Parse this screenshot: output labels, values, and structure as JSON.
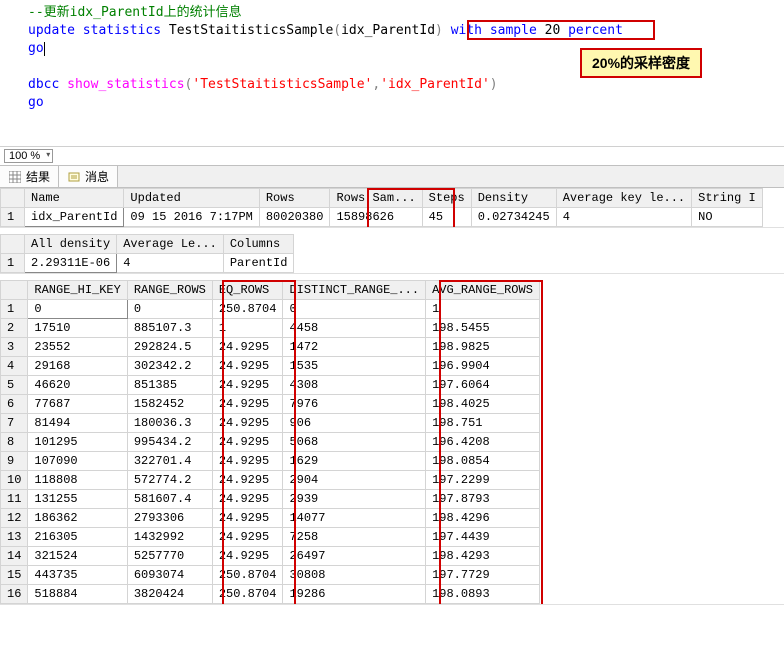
{
  "code": {
    "c1": "--更新idx_ParentId上的统计信息",
    "c2a": "update",
    "c2b": "statistics",
    "c2c": "TestStaitisticsSample",
    "c2d": "(",
    "c2e": "idx_ParentId",
    "c2f": ")",
    "c2g": "with",
    "c2h": "sample",
    "c2i": "20",
    "c2j": "percent",
    "c3": "go",
    "c5a": "dbcc",
    "c5b": "show_statistics",
    "c5c": "(",
    "c5d": "'TestStaitisticsSample'",
    "c5e": ",",
    "c5f": "'idx_ParentId'",
    "c5g": ")",
    "c6": "go"
  },
  "zoom": {
    "value": "100 %"
  },
  "tabs": {
    "results": "结果",
    "messages": "消息"
  },
  "annotation": {
    "label": "20%的采样密度"
  },
  "grid1": {
    "headers": [
      "Name",
      "Updated",
      "Rows",
      "Rows Sam...",
      "Steps",
      "Density",
      "Average key le...",
      "String I"
    ],
    "rows": [
      {
        "n": "1",
        "cells": [
          "idx_ParentId",
          "09 15 2016  7:17PM",
          "80020380",
          "15898626",
          "45",
          "0.02734245",
          "4",
          "NO"
        ]
      }
    ]
  },
  "grid2": {
    "headers": [
      "All density",
      "Average Le...",
      "Columns"
    ],
    "rows": [
      {
        "n": "1",
        "cells": [
          "2.29311E-06",
          "4",
          "ParentId"
        ]
      }
    ]
  },
  "grid3": {
    "headers": [
      "RANGE_HI_KEY",
      "RANGE_ROWS",
      "EQ_ROWS",
      "DISTINCT_RANGE_...",
      "AVG_RANGE_ROWS"
    ],
    "rows": [
      {
        "n": "1",
        "cells": [
          "0",
          "0",
          "250.8704",
          "0",
          "1"
        ]
      },
      {
        "n": "2",
        "cells": [
          "17510",
          "885107.3",
          "1",
          "4458",
          "198.5455"
        ]
      },
      {
        "n": "3",
        "cells": [
          "23552",
          "292824.5",
          "24.9295",
          "1472",
          "198.9825"
        ]
      },
      {
        "n": "4",
        "cells": [
          "29168",
          "302342.2",
          "24.9295",
          "1535",
          "196.9904"
        ]
      },
      {
        "n": "5",
        "cells": [
          "46620",
          "851385",
          "24.9295",
          "4308",
          "197.6064"
        ]
      },
      {
        "n": "6",
        "cells": [
          "77687",
          "1582452",
          "24.9295",
          "7976",
          "198.4025"
        ]
      },
      {
        "n": "7",
        "cells": [
          "81494",
          "180036.3",
          "24.9295",
          "906",
          "198.751"
        ]
      },
      {
        "n": "8",
        "cells": [
          "101295",
          "995434.2",
          "24.9295",
          "5068",
          "196.4208"
        ]
      },
      {
        "n": "9",
        "cells": [
          "107090",
          "322701.4",
          "24.9295",
          "1629",
          "198.0854"
        ]
      },
      {
        "n": "10",
        "cells": [
          "118808",
          "572774.2",
          "24.9295",
          "2904",
          "197.2299"
        ]
      },
      {
        "n": "11",
        "cells": [
          "131255",
          "581607.4",
          "24.9295",
          "2939",
          "197.8793"
        ]
      },
      {
        "n": "12",
        "cells": [
          "186362",
          "2793306",
          "24.9295",
          "14077",
          "198.4296"
        ]
      },
      {
        "n": "13",
        "cells": [
          "216305",
          "1432992",
          "24.9295",
          "7258",
          "197.4439"
        ]
      },
      {
        "n": "14",
        "cells": [
          "321524",
          "5257770",
          "24.9295",
          "26497",
          "198.4293"
        ]
      },
      {
        "n": "15",
        "cells": [
          "443735",
          "6093074",
          "250.8704",
          "30808",
          "197.7729"
        ]
      },
      {
        "n": "16",
        "cells": [
          "518884",
          "3820424",
          "250.8704",
          "19286",
          "198.0893"
        ]
      }
    ]
  }
}
